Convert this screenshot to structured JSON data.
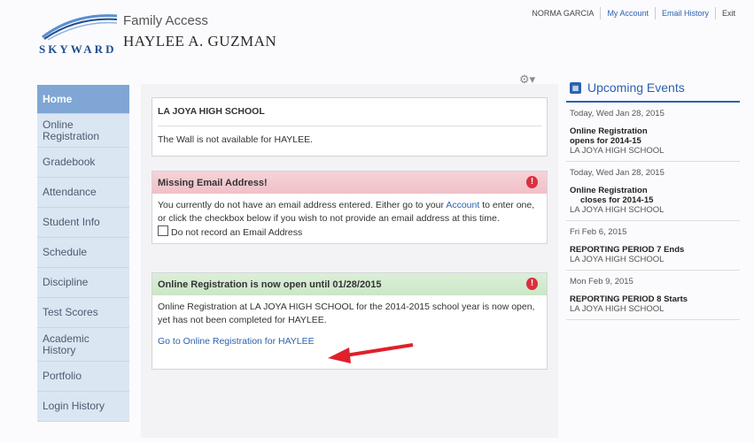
{
  "header": {
    "logo_text": "SKYWARD",
    "app_title": "Family Access",
    "student_name": "HAYLEE A. GUZMAN",
    "top_links": [
      "NORMA GARCIA",
      "My Account",
      "Email History",
      "Exit"
    ]
  },
  "nav": {
    "items": [
      "Home",
      "Online Registration",
      "Gradebook",
      "Attendance",
      "Student Info",
      "Schedule",
      "Discipline",
      "Test Scores",
      "Academic History",
      "Portfolio",
      "Login History"
    ]
  },
  "main": {
    "school_card": {
      "title": "LA JOYA HIGH SCHOOL",
      "message": "The Wall is not available for HAYLEE."
    },
    "email_card": {
      "title": "Missing Email Address!",
      "text_before": "You currently do not have an email address entered. Either go to your ",
      "link": "Account",
      "text_after": " to enter one, or click the checkbox below if you wish to not provide an email address at this time.",
      "checkbox_label": "Do not record an Email Address"
    },
    "registration_card": {
      "title": "Online Registration is now open until 01/28/2015",
      "message": "Online Registration at LA JOYA HIGH SCHOOL for the 2014-2015 school year is now open, yet has not been completed for HAYLEE.",
      "link": "Go to Online Registration for HAYLEE"
    },
    "alert_symbol": "!"
  },
  "events": {
    "title": "Upcoming Events",
    "items": [
      {
        "date": "Today, Wed Jan 28, 2015",
        "title": "Online Registration opens for 2014-15",
        "location": "LA JOYA HIGH SCHOOL"
      },
      {
        "date": "Today, Wed Jan 28, 2015",
        "title_line1": "Online Registration",
        "title_line2": "closes for 2014-15",
        "location": "LA JOYA HIGH SCHOOL"
      },
      {
        "date": "Fri Feb 6, 2015",
        "title": "REPORTING PERIOD 7 Ends",
        "location": "LA JOYA HIGH SCHOOL"
      },
      {
        "date": "Mon Feb 9, 2015",
        "title": "REPORTING PERIOD 8 Starts",
        "location": "LA JOYA HIGH SCHOOL"
      }
    ]
  },
  "colors": {
    "accent": "#2b62b0",
    "nav_active": "#7fa6d4",
    "alert": "#d9303e",
    "arrow": "#e0202a"
  }
}
